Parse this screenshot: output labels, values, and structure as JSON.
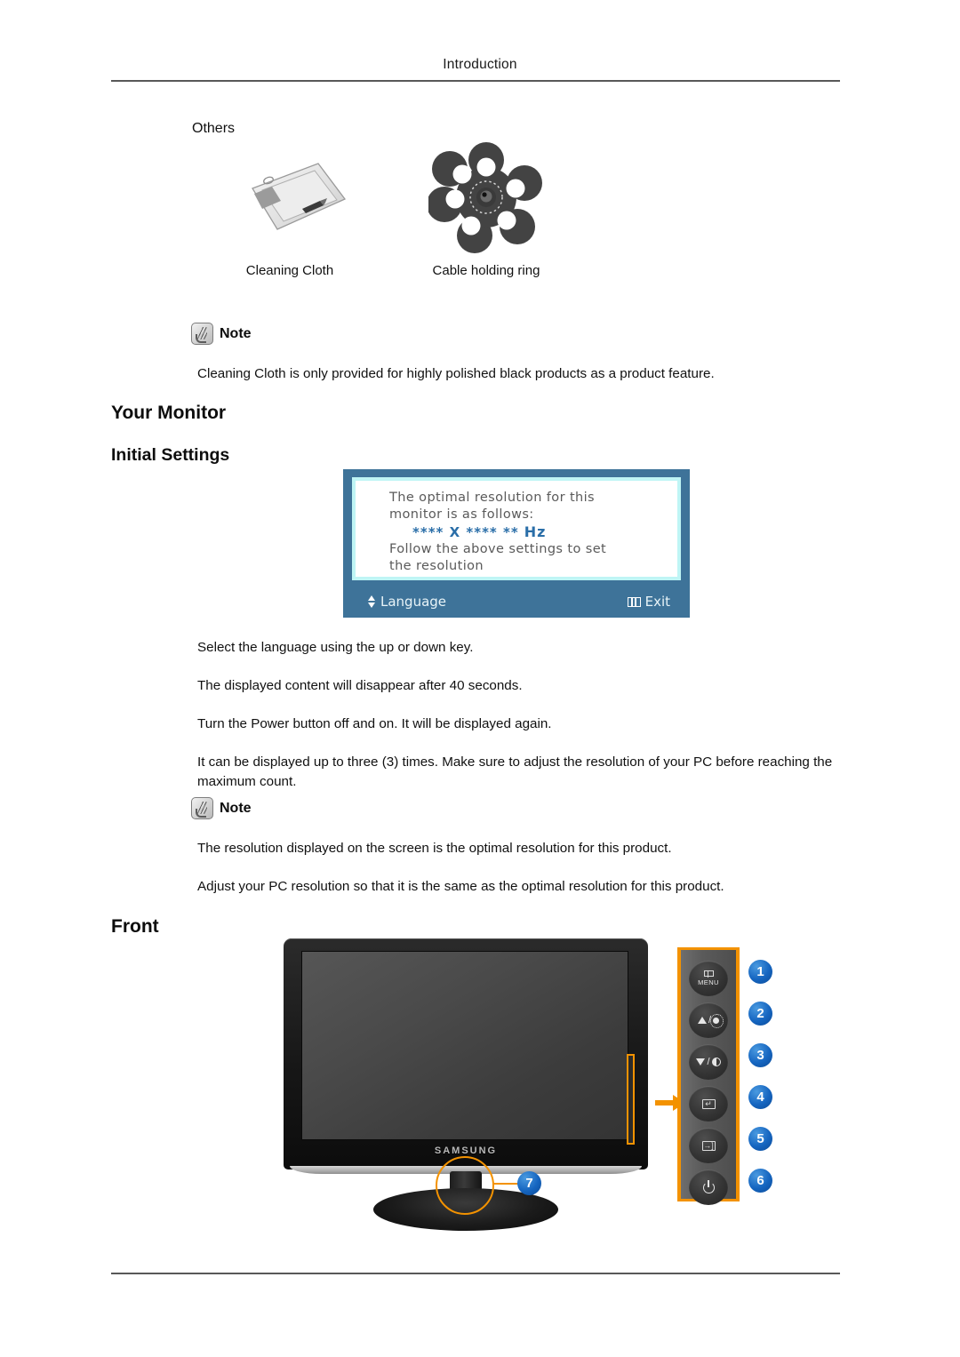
{
  "header": {
    "title": "Introduction"
  },
  "others_section": {
    "label": "Others",
    "items": [
      {
        "caption": "Cleaning Cloth",
        "icon": "cleaning-cloth-image"
      },
      {
        "caption": "Cable holding ring",
        "icon": "cable-holding-ring-image"
      }
    ]
  },
  "note1": {
    "label": "Note",
    "icon": "note-hand-icon",
    "text": "Cleaning Cloth is only provided for highly polished black products as a product feature."
  },
  "headings": {
    "your_monitor": "Your Monitor",
    "initial_settings": "Initial Settings",
    "front": "Front"
  },
  "osd": {
    "line1": "The optimal resolution for this",
    "line2": "monitor is as follows:",
    "resolution": "**** X **** **",
    "hz": "Hz",
    "line3": "Follow the above settings to set",
    "line4": "the resolution",
    "language_label": "Language",
    "language_icon": "up-down-arrow-icon",
    "exit_label": "Exit",
    "exit_icon": "menu-icon",
    "colors": {
      "frame": "#3e7399",
      "inner_border": "#bff5f5",
      "content_bg": "#ffffff",
      "body_text": "#5a5a5a",
      "accent_text": "#2a6ea8"
    }
  },
  "body_paragraphs": [
    "Select the language using the up or down key.",
    "The displayed content will disappear after 40 seconds.",
    "Turn the Power button off and on. It will be displayed again.",
    "It can be displayed up to three (3) times. Make sure to adjust the resolution of your PC before reaching the maximum count."
  ],
  "note2": {
    "label": "Note",
    "icon": "note-hand-icon",
    "paragraphs": [
      "The resolution displayed on the screen is the optimal resolution for this product.",
      "Adjust your PC resolution so that it is the same as the optimal resolution for this product."
    ]
  },
  "monitor": {
    "brand": "SAMSUNG",
    "callout_power_led": "7",
    "highlight_color": "#f39200",
    "callout_color": "#1565c0"
  },
  "control_panel": {
    "buttons": [
      {
        "number": "1",
        "label": "MENU",
        "icon": "menu-button-icon"
      },
      {
        "number": "2",
        "label": "",
        "icon": "up-brightness-icon"
      },
      {
        "number": "3",
        "label": "",
        "icon": "down-contrast-icon"
      },
      {
        "number": "4",
        "label": "",
        "icon": "enter-button-icon"
      },
      {
        "number": "5",
        "label": "",
        "icon": "source-button-icon"
      },
      {
        "number": "6",
        "label": "",
        "icon": "power-button-icon"
      }
    ]
  }
}
